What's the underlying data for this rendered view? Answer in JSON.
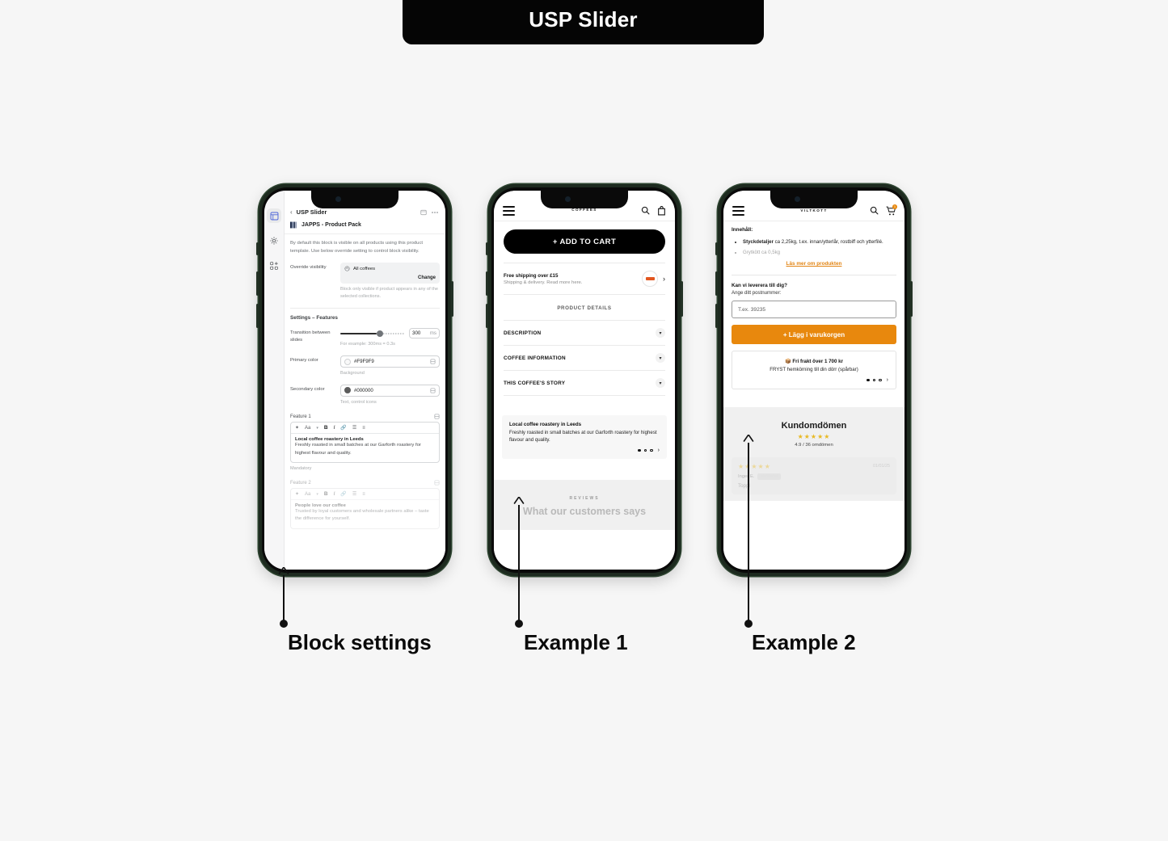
{
  "banner": {
    "title": "USP Slider"
  },
  "annotations": [
    {
      "label": "Block settings"
    },
    {
      "label": "Example 1"
    },
    {
      "label": "Example 2"
    }
  ],
  "phone1": {
    "rail": [
      {
        "icon": "sections-grid-icon",
        "active": true
      },
      {
        "icon": "gear-icon",
        "active": false
      },
      {
        "icon": "apps-add-icon",
        "active": false
      }
    ],
    "back_icon": "chevron-left-icon",
    "title": "USP Slider",
    "top_icons": [
      "preview-icon",
      "more-menu-icon"
    ],
    "app_name": "JAPPS - Product Pack",
    "description": "By default this block is visible on all products using this product template. Use below override setting to control block visibility.",
    "override": {
      "label": "Override visibility",
      "value": "All coffees",
      "change_label": "Change",
      "hint": "Block only visible if product appears in any of the selected collections."
    },
    "settings_title": "Settings – Features",
    "transition": {
      "label": "Transition between slides",
      "value": "300",
      "unit": "ms",
      "hint": "For example: 300ms = 0.3s"
    },
    "primary_color": {
      "label": "Primary color",
      "value": "#F9F9F9",
      "swatch": "#F9F9F9",
      "hint": "Background"
    },
    "secondary_color": {
      "label": "Secondary color",
      "value": "#000000",
      "swatch": "#5c5c5c",
      "hint": "Text, control icons"
    },
    "rte_tools": [
      "magic-icon",
      "text-style-icon",
      "chevron-down-icon",
      "bold-icon",
      "italic-icon",
      "link-icon",
      "bullet-list-icon",
      "numbered-list-icon"
    ],
    "features": [
      {
        "label": "Feature 1",
        "heading": "Local coffee roastery in Leeds",
        "body": "Freshly roasted in small batches at our Garforth roastery for highest flavour and quality.",
        "footnote": "Mandatory"
      },
      {
        "label": "Feature 2",
        "heading": "People love our coffee",
        "body": "Trusted by loyal customers and wholesale partners alike – taste the difference for yourself.",
        "footnote": ""
      }
    ]
  },
  "phone2": {
    "header": {
      "menu_icon": "hamburger-icon",
      "logo_text": "COFFEES",
      "search_icon": "search-icon",
      "cart_icon": "cart-bag-icon"
    },
    "add_to_cart": "+ ADD TO CART",
    "shipping": {
      "title": "Free shipping over £15",
      "subtitle": "Shipping & delivery. Read more here.",
      "arrow_icon": "chevron-right-icon"
    },
    "product_details_title": "PRODUCT DETAILS",
    "accordions": [
      {
        "label": "DESCRIPTION",
        "icon": "chevron-down-icon"
      },
      {
        "label": "COFFEE INFORMATION",
        "icon": "chevron-down-icon"
      },
      {
        "label": "THIS COFFEE'S STORY",
        "icon": "chevron-down-icon"
      }
    ],
    "usp": {
      "heading": "Local coffee roastery in Leeds",
      "body": "Freshly roasted in small batches at our Garforth roastery for highest flavour and quality.",
      "dots": 3,
      "active_dot": 0,
      "next_icon": "chevron-right-icon"
    },
    "reviews": {
      "kicker": "REVIEWS",
      "title": "What our customers says"
    }
  },
  "phone3": {
    "header": {
      "menu_icon": "hamburger-icon",
      "logo_text": "VILTKOTT",
      "search_icon": "search-icon",
      "cart_icon": "cart-icon",
      "cart_badge": "1"
    },
    "content_title": "Innehåll:",
    "content_items": [
      {
        "bold": "Styckdetaljer",
        "rest": " ca 2,25kg, t.ex. innan/ytterlår, rostbiff och ytterfilé."
      },
      {
        "bold": "",
        "rest": "Grytkött ca 0,5kg"
      }
    ],
    "read_more": "Läs mer om produkten",
    "delivery_question": "Kan vi leverera till dig?",
    "delivery_sub": "Ange ditt postnummer:",
    "postcode_placeholder": "T.ex. 39235",
    "cta": "+ Lägg i varukorgen",
    "usp": {
      "heading": "📦 Fri frakt över 1 700 kr",
      "body": "FRYST hemkörning till din dörr (spårbar)",
      "dots": 3,
      "active_dot": 0,
      "next_icon": "chevron-right-icon"
    },
    "reviews": {
      "title": "Kundomdömen",
      "stars": "★★★★★",
      "summary": "4.9 / 36 omdömen",
      "card": {
        "stars": "★★★★★",
        "date": "01/01/25",
        "name": "Inger E.",
        "verified": "Verifierad",
        "body": "Toppl"
      }
    }
  },
  "colors": {
    "background": "#f6f6f6",
    "banner_bg": "#050505",
    "phone_bezel": "#1d2a1f",
    "accent_orange": "#e8880d",
    "link_orange": "#e28413",
    "star_gold": "#e8b923"
  }
}
